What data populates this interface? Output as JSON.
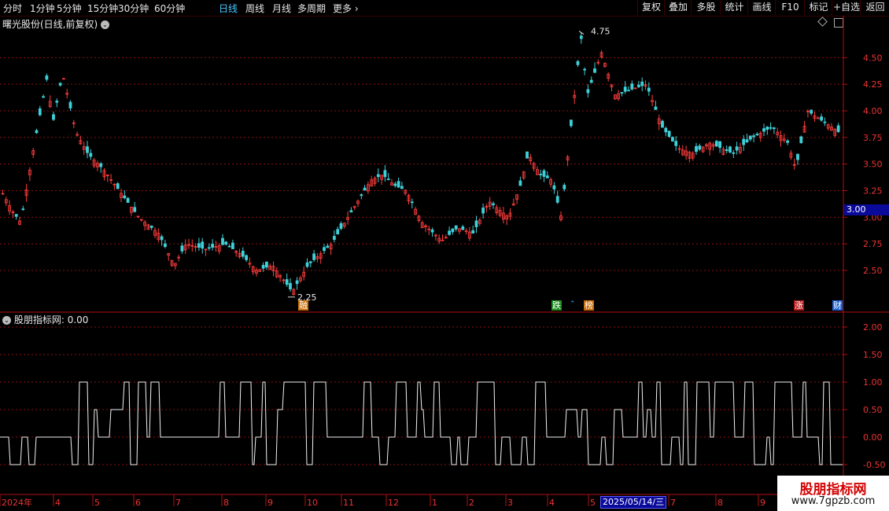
{
  "toolbar": {
    "periods": [
      "分时",
      "1分钟",
      "5分钟",
      "15分钟",
      "30分钟",
      "60分钟",
      "日线",
      "周线",
      "月线",
      "多周期",
      "更多"
    ],
    "active_period": "日线",
    "right_buttons": [
      "复权",
      "叠加",
      "多股",
      "统计",
      "画线",
      "F10",
      "标记",
      "+自选",
      "返回"
    ]
  },
  "main_panel": {
    "title": "曙光股份(日线,前复权)",
    "price_axis": [
      "4.50",
      "4.25",
      "4.00",
      "3.75",
      "3.50",
      "3.25",
      "3.00",
      "2.75",
      "2.50"
    ],
    "current_price_tag": "3.00",
    "high_marker": "4.75",
    "low_marker": "2.25",
    "event_badges": [
      {
        "text": "融",
        "color": "#c86a00"
      },
      {
        "text": "跌",
        "color": "#1b8a1b"
      },
      {
        "text": "榜",
        "color": "#c86a00"
      },
      {
        "text": "涨",
        "color": "#b01818"
      },
      {
        "text": "财",
        "color": "#1a5fd0"
      }
    ],
    "colors": {
      "up": "#ff3c3c",
      "down": "#3fd0d8",
      "grid": "#8a1010",
      "axis": "#b01010"
    }
  },
  "indicator_panel": {
    "title": "股朋指标网",
    "value": ": 0.00",
    "axis": [
      "2.00",
      "1.50",
      "1.00",
      "0.50",
      "0.00",
      "-0.50"
    ]
  },
  "time_axis": {
    "labels": [
      "2024年",
      "4",
      "5",
      "6",
      "7",
      "8",
      "9",
      "10",
      "11",
      "12",
      "1",
      "2",
      "3",
      "4",
      "5",
      "7",
      "8",
      "9"
    ],
    "highlight": "2025/05/14/三"
  },
  "watermark": {
    "line1": "股朋指标网",
    "line2": "www.7gpzb.com"
  }
}
